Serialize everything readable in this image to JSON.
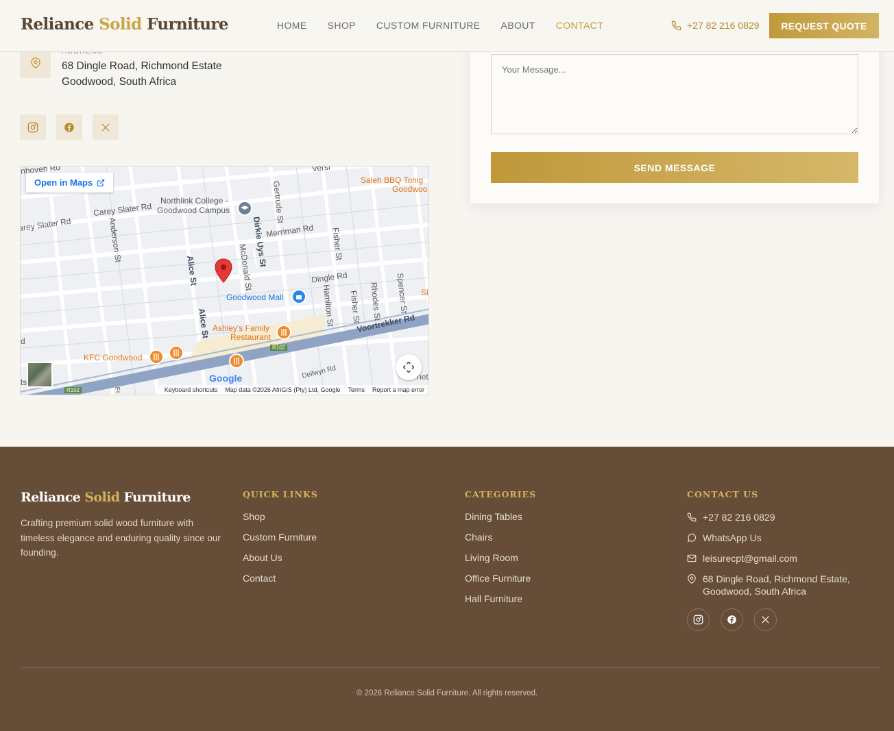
{
  "header": {
    "logo_part1": "Reliance",
    "logo_accent": "Solid",
    "logo_part2": "Furniture",
    "nav": [
      "HOME",
      "SHOP",
      "CUSTOM FURNITURE",
      "ABOUT",
      "CONTACT"
    ],
    "active_nav": "CONTACT",
    "phone": "+27 82 216 0829",
    "quote_label": "REQUEST QUOTE"
  },
  "contact_info": {
    "address_label": "ADDRESS",
    "address_line1": "68 Dingle Road, Richmond Estate",
    "address_line2": "Goodwood, South Africa",
    "social_icons": [
      "instagram-icon",
      "facebook-icon",
      "x-twitter-icon"
    ]
  },
  "map": {
    "open_label": "Open in Maps",
    "labels": {
      "saleh": "Saleh BBQ Tonig",
      "goodwood_cut": "Goodwoo",
      "northlink1": "Northlink College -",
      "northlink2": "Goodwood Campus",
      "carey1": "Carey Slater Rd",
      "carey2": "arey Slater Rd",
      "gertrude": "Gertrude St",
      "merriman": "Merriman Rd",
      "anderson": "Anderson St",
      "dirkie": "Dirkie Uys St",
      "fisher1": "Fisher St",
      "mcdonald": "McDonald St",
      "alice1": "Alice St",
      "dingle": "Dingle Rd",
      "goodwood_mall": "Goodwood Mall",
      "hamilton": "Hamilton St",
      "fisher2": "Fisher St",
      "rhodes": "Rhodes St",
      "spencer": "Spencer St",
      "alice2": "Alice St",
      "ashley1": "Ashley's Family",
      "ashley2": "Restaurant",
      "voortrekker": "Voortrekker Rd",
      "r102": "R102",
      "kfc": "KFC Goodwood",
      "dellwyn": "Dellwyn Rd",
      "edge_top": "nhoven Ro",
      "edge_vers": "Versi",
      "edge_sl": "Sl",
      "edge_d": "d",
      "edge_ts": "ts",
      "edge_fr": "Fr",
      "edge_net": "net"
    },
    "google": "Google",
    "footer": [
      "Keyboard shortcuts",
      "Map data ©2026 AfriGIS (Pty) Ltd, Google",
      "Terms",
      "Report a map error"
    ]
  },
  "form": {
    "message_placeholder": "Your Message...",
    "send_label": "SEND MESSAGE"
  },
  "footer": {
    "logo_part1": "Reliance",
    "logo_accent": "Solid",
    "logo_part2": "Furniture",
    "description": "Crafting premium solid wood furniture with timeless elegance and enduring quality since our founding.",
    "quick_links_title": "QUICK LINKS",
    "quick_links": [
      "Shop",
      "Custom Furniture",
      "About Us",
      "Contact"
    ],
    "categories_title": "CATEGORIES",
    "categories": [
      "Dining Tables",
      "Chairs",
      "Living Room",
      "Office Furniture",
      "Hall Furniture"
    ],
    "contact_title": "CONTACT US",
    "phone": "+27 82 216 0829",
    "whatsapp": "WhatsApp Us",
    "email": "leisurecpt@gmail.com",
    "address": "68 Dingle Road, Richmond Estate, Goodwood, South Africa",
    "copyright": "© 2026 Reliance Solid Furniture. All rights reserved."
  },
  "colors": {
    "gold": "#c9a544",
    "brown": "#654d38",
    "cream": "#f7f5f0"
  }
}
